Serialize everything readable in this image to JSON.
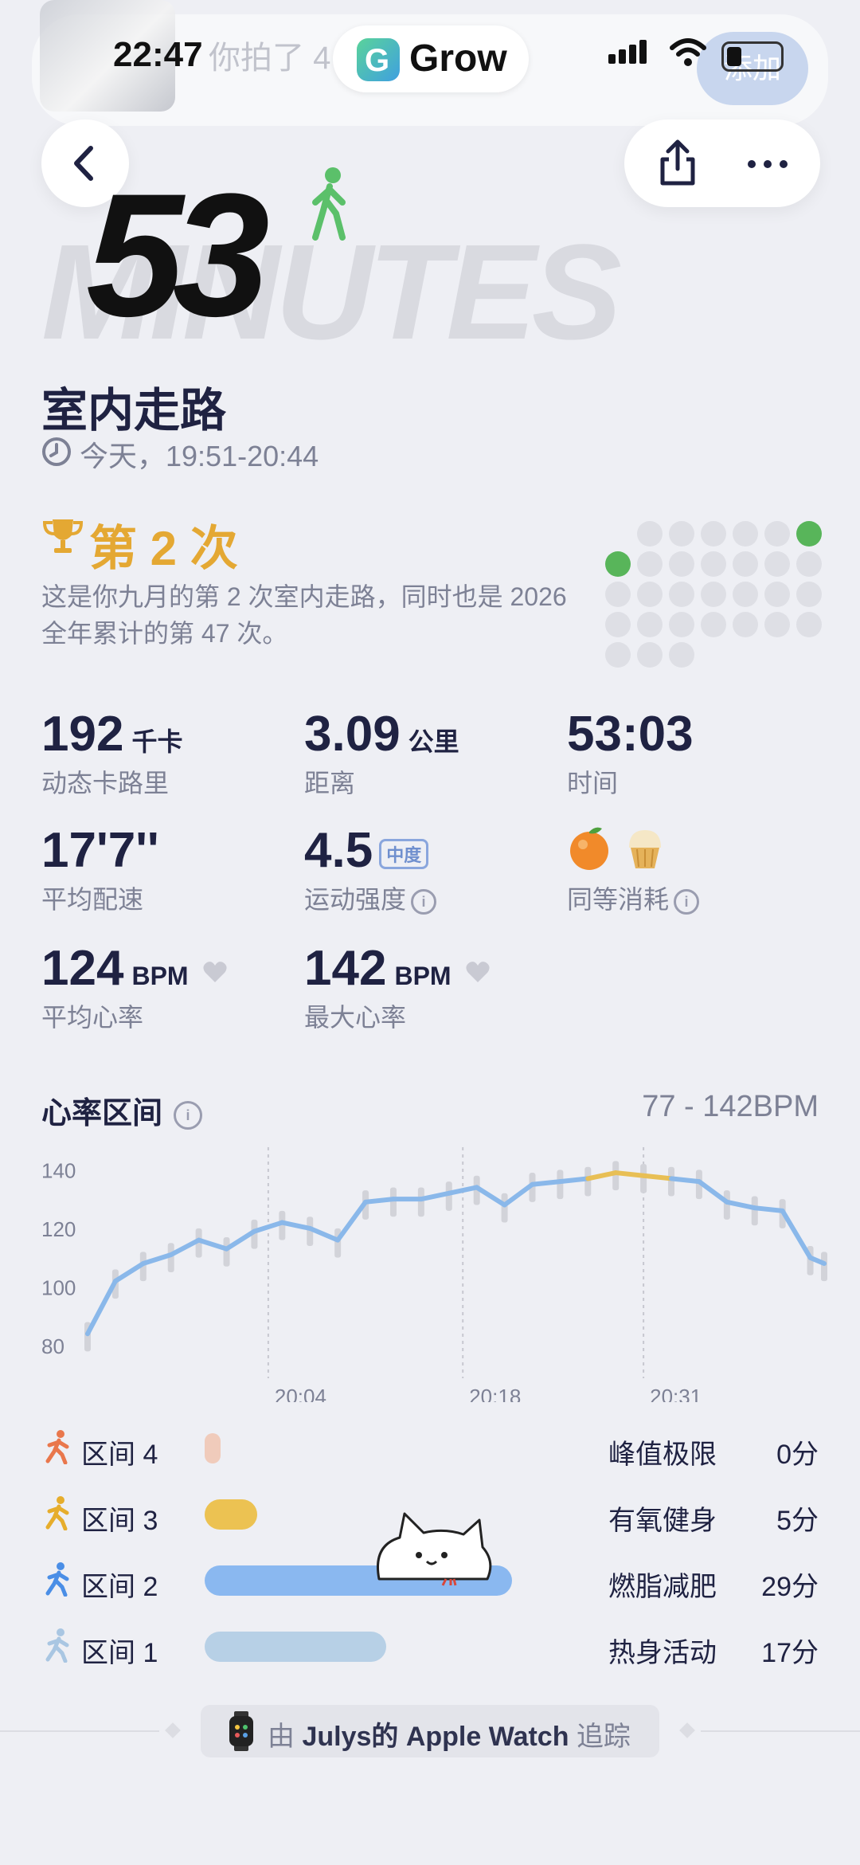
{
  "status_bar": {
    "time": "22:47",
    "app_pill": "Grow",
    "notification_text": "你拍了 4",
    "notification_button": "添加"
  },
  "hero": {
    "minutes": "53",
    "unit_word": "MINUTES",
    "activity_icon": "walking-person-icon"
  },
  "workout": {
    "title": "室内走路",
    "time_range": "今天，19:51-20:44"
  },
  "rank": {
    "title": "第 2 次",
    "description": "这是你九月的第 2 次室内走路，同时也是 2026 全年累计的第 47 次。"
  },
  "stats": [
    {
      "value": "192",
      "unit": "千卡",
      "label": "动态卡路里"
    },
    {
      "value": "3.09",
      "unit": "公里",
      "label": "距离"
    },
    {
      "value": "53:03",
      "unit": "",
      "label": "时间"
    },
    {
      "value": "17'7''",
      "unit": "",
      "label": "平均配速"
    },
    {
      "value": "4.5",
      "unit": "中度",
      "label": "运动强度"
    },
    {
      "value": "",
      "unit": "",
      "label": "同等消耗"
    },
    {
      "value": "124",
      "unit": "BPM",
      "label": "平均心率"
    },
    {
      "value": "142",
      "unit": "BPM",
      "label": "最大心率"
    }
  ],
  "heart_rate": {
    "title": "心率区间",
    "range": "77 - 142BPM"
  },
  "chart_data": {
    "type": "line",
    "title": "",
    "ylim": [
      77,
      145
    ],
    "yticks": [
      "140",
      "120",
      "100",
      "80"
    ],
    "xticks": [
      "20:04",
      "20:18",
      "20:31"
    ],
    "x": [
      "19:51",
      "19:53",
      "19:55",
      "19:57",
      "19:59",
      "20:01",
      "20:03",
      "20:05",
      "20:07",
      "20:09",
      "20:11",
      "20:13",
      "20:15",
      "20:17",
      "20:19",
      "20:21",
      "20:23",
      "20:25",
      "20:27",
      "20:29",
      "20:31",
      "20:33",
      "20:35",
      "20:37",
      "20:39",
      "20:41",
      "20:43",
      "20:44"
    ],
    "series": [
      {
        "values": [
          84,
          102,
          108,
          111,
          116,
          113,
          119,
          122,
          120,
          116,
          129,
          130,
          130,
          132,
          134,
          128,
          135,
          136,
          137,
          139,
          138,
          137,
          136,
          129,
          127,
          126,
          110,
          108
        ]
      }
    ],
    "colors": {
      "line": "#8ab8ea",
      "peak": "#e8bf55",
      "bands": "#d2d3d9"
    }
  },
  "zones": [
    {
      "label": "区间 4",
      "name": "峰值极限",
      "minutes": "0分",
      "color": "#f0cbbb",
      "icon": "running-person-icon",
      "icon_color": "#e9774c",
      "fraction": 0
    },
    {
      "label": "区间 3",
      "name": "有氧健身",
      "minutes": "5分",
      "color": "#ecc252",
      "icon": "running-person-icon",
      "icon_color": "#e6ad2c",
      "fraction": 0.17
    },
    {
      "label": "区间 2",
      "name": "燃脂减肥",
      "minutes": "29分",
      "color": "#8ab8f0",
      "icon": "running-person-icon",
      "icon_color": "#4a8ee6",
      "fraction": 1
    },
    {
      "label": "区间 1",
      "name": "热身活动",
      "minutes": "17分",
      "color": "#b7d0e6",
      "icon": "walking-person-icon",
      "icon_color": "#a9c6e2",
      "fraction": 0.59
    }
  ],
  "footer": {
    "prefix": "由",
    "device": "Julys的 Apple Watch",
    "suffix": "追踪"
  },
  "colors": {
    "accent_gold": "#e4a833",
    "green": "#58b55a",
    "background": "#eeeff4"
  }
}
